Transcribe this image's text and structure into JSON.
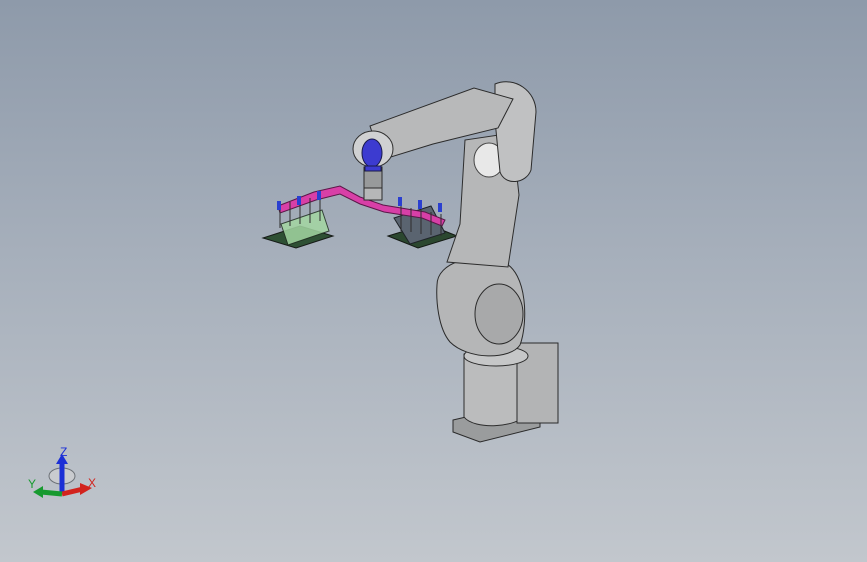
{
  "viewport": {
    "background_top": "#8e9aaa",
    "background_bottom": "#c2c7cd"
  },
  "model": {
    "robot_color": "#b9babb",
    "gripper_color": "#d83fa7",
    "tool_flange_color": "#3c3bd0",
    "fixture_color": "#3f6b4a"
  },
  "triad": {
    "x_label": "X",
    "y_label": "Y",
    "z_label": "Z",
    "x_color": "#d2231d",
    "y_color": "#179a2f",
    "z_color": "#1b2fd6"
  }
}
